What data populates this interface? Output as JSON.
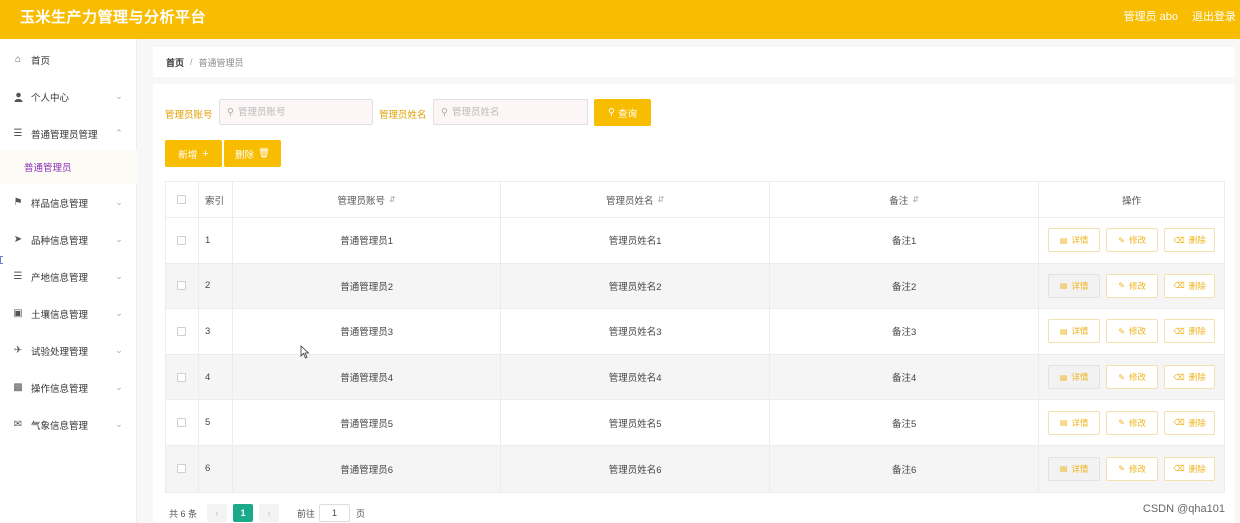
{
  "header": {
    "title": "玉米生产力管理与分析平台",
    "user": "管理员 abo",
    "logout": "退出登录"
  },
  "sidebar": {
    "items": [
      {
        "label": "首页",
        "icon": "home-icon"
      },
      {
        "label": "个人中心",
        "icon": "user-icon"
      },
      {
        "label": "普通管理员管理",
        "icon": "menu-icon"
      },
      {
        "label": "样品信息管理",
        "icon": "flag-icon"
      },
      {
        "label": "品种信息管理",
        "icon": "send-icon"
      },
      {
        "label": "产地信息管理",
        "icon": "menu-icon"
      },
      {
        "label": "土壤信息管理",
        "icon": "message-icon"
      },
      {
        "label": "试验处理管理",
        "icon": "plane-icon"
      },
      {
        "label": "操作信息管理",
        "icon": "chart-icon"
      },
      {
        "label": "气象信息管理",
        "icon": "mail-icon"
      }
    ],
    "sub_item": "普通管理员"
  },
  "breadcrumb": {
    "home": "首页",
    "sep": "/",
    "current": "普通管理员"
  },
  "search": {
    "account_label": "管理员账号",
    "account_placeholder": "管理员账号",
    "name_label": "管理员姓名",
    "name_placeholder": "管理员姓名",
    "query_button": "查询"
  },
  "actions": {
    "add": "新增",
    "delete": "删除"
  },
  "table": {
    "headers": {
      "index": "索引",
      "account": "管理员账号",
      "name": "管理员姓名",
      "note": "备注",
      "ops": "操作"
    },
    "rows": [
      {
        "index": "1",
        "account": "普通管理员1",
        "name": "管理员姓名1",
        "note": "备注1"
      },
      {
        "index": "2",
        "account": "普通管理员2",
        "name": "管理员姓名2",
        "note": "备注2"
      },
      {
        "index": "3",
        "account": "普通管理员3",
        "name": "管理员姓名3",
        "note": "备注3"
      },
      {
        "index": "4",
        "account": "普通管理员4",
        "name": "管理员姓名4",
        "note": "备注4"
      },
      {
        "index": "5",
        "account": "普通管理员5",
        "name": "管理员姓名5",
        "note": "备注5"
      },
      {
        "index": "6",
        "account": "普通管理员6",
        "name": "管理员姓名6",
        "note": "备注6"
      }
    ],
    "op_labels": {
      "detail": "详情",
      "edit": "修改",
      "delete": "删除"
    }
  },
  "pagination": {
    "total": "共 6 条",
    "current_page": "1",
    "goto_label": "前往",
    "goto_value": "1",
    "page_unit": "页"
  },
  "watermark": "CSDN @qha101",
  "colors": {
    "accent": "#f8bc00",
    "active_page": "#1aaa8a",
    "submenu_active": "#8b2fb8"
  }
}
